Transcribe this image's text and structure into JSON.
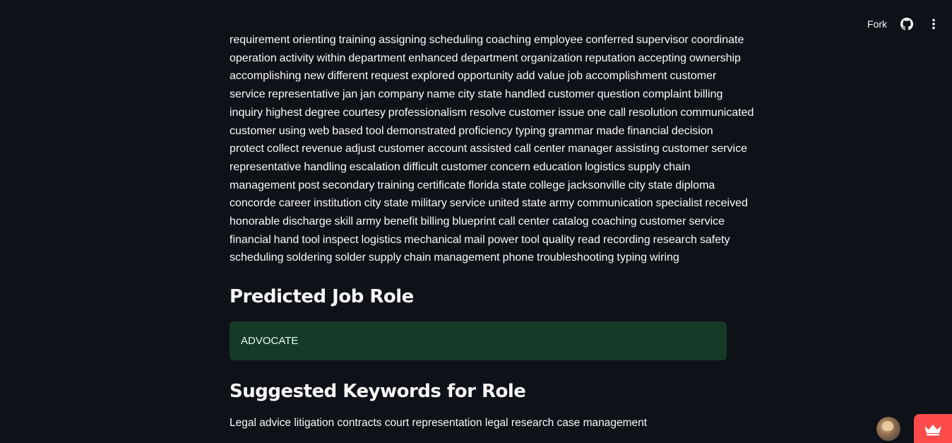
{
  "toolbar": {
    "fork_label": "Fork",
    "github_icon": "github-icon",
    "menu_icon": "vertical-dots-icon"
  },
  "resume": {
    "lines": [
      "requirement orienting training assigning scheduling coaching employee conferred supervisor coordinate",
      "operation activity within department enhanced department organization reputation accepting ownership",
      "accomplishing new different request explored opportunity add value job accomplishment customer",
      "service representative jan jan company name city state handled customer question complaint billing",
      "inquiry highest degree courtesy professionalism resolve customer issue one call resolution communicated",
      "customer using web based tool demonstrated proficiency typing grammar made financial decision",
      "protect collect revenue adjust customer account assisted call center manager assisting customer service",
      "representative handling escalation difficult customer concern education logistics supply chain",
      "management post secondary training certificate florida state college jacksonville city state diploma",
      "concorde career institution city state military service united state army communication specialist received",
      "honorable discharge skill army benefit billing blueprint call center catalog coaching customer service",
      "financial hand tool inspect logistics mechanical mail power tool quality read recording research safety",
      "scheduling soldering solder supply chain management phone troubleshooting typing wiring"
    ]
  },
  "prediction": {
    "title": "Predicted Job Role",
    "role": "ADVOCATE"
  },
  "keywords": {
    "title": "Suggested Keywords for Role",
    "text": "Legal advice litigation contracts court representation legal research case management"
  },
  "footer": {
    "avatar_icon": "user-avatar",
    "badge_icon": "crown-icon"
  },
  "colors": {
    "background": "#0e1117",
    "success_bg": "#173928",
    "success_text": "#dffde9",
    "badge": "#ff4b4b"
  }
}
